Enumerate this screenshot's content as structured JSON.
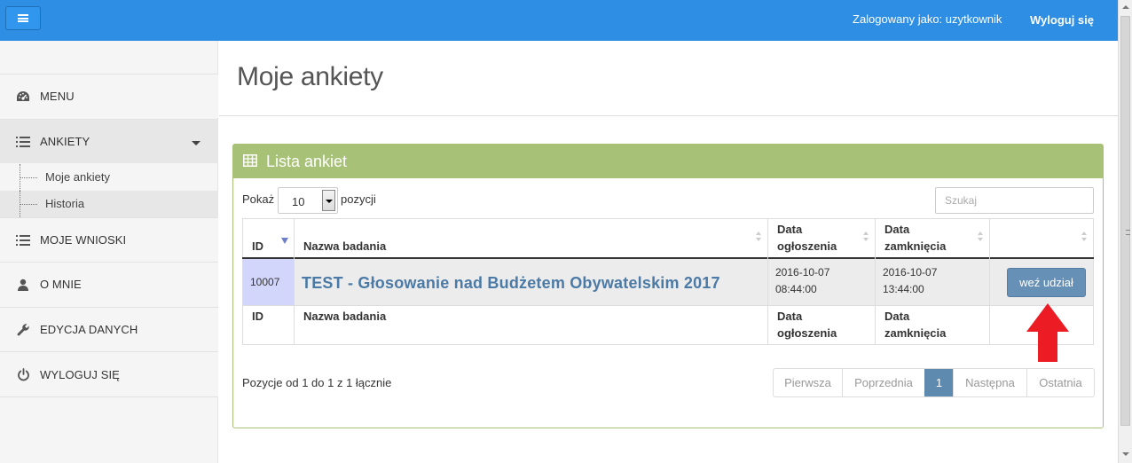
{
  "topbar": {
    "logged_in_as": "Zalogowany jako: uzytkownik",
    "logout": "Wyloguj się",
    "color": "#2d8ee3"
  },
  "sidebar": {
    "items": [
      {
        "label": "MENU",
        "icon": "dashboard-icon"
      },
      {
        "label": "ANKIETY",
        "icon": "list-icon"
      },
      {
        "label": "MOJE WNIOSKI",
        "icon": "list-icon"
      },
      {
        "label": "O MNIE",
        "icon": "user-icon"
      },
      {
        "label": "EDYCJA DANYCH",
        "icon": "wrench-icon"
      },
      {
        "label": "WYLOGUJ SIĘ",
        "icon": "power-icon"
      }
    ],
    "subitems": [
      {
        "label": "Moje ankiety"
      },
      {
        "label": "Historia"
      }
    ]
  },
  "page": {
    "title": "Moje ankiety"
  },
  "panel": {
    "title": "Lista ankiet",
    "header_color": "#a7c177",
    "show_label": "Pokaż",
    "page_size": "10",
    "positions_label": "pozycji",
    "search_placeholder": "Szukaj"
  },
  "table": {
    "headers": {
      "id": "ID",
      "name": "Nazwa badania",
      "announced_1": "Data",
      "announced_2": "ogłoszenia",
      "closed_1": "Data",
      "closed_2": "zamknięcia"
    },
    "rows": [
      {
        "id": "10007",
        "name": "TEST - Głosowanie nad Budżetem Obywatelskim 2017",
        "announced_date": "2016-10-07",
        "announced_time": "08:44:00",
        "closed_date": "2016-10-07",
        "closed_time": "13:44:00",
        "action": "weź udział"
      }
    ]
  },
  "footer": {
    "info": "Pozycje od 1 do 1 z 1 łącznie",
    "pager": {
      "first": "Pierwsza",
      "prev": "Poprzednia",
      "current": "1",
      "next": "Następna",
      "last": "Ostatnia"
    }
  }
}
